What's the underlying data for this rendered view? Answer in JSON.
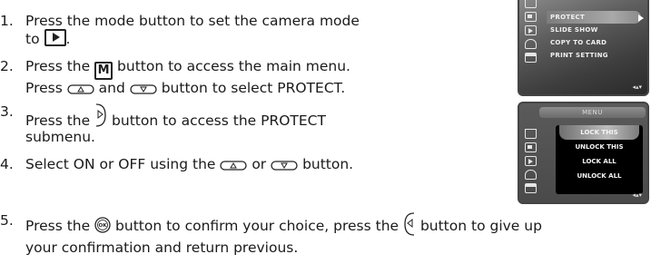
{
  "steps": [
    {
      "num": "1.",
      "line1": "Press the mode button to set the camera mode",
      "line2_pre": "to",
      "line2_post": "."
    },
    {
      "num": "2.",
      "line1_pre": "Press the",
      "line1_post": "button to access the main menu.",
      "line2_pre": "Press",
      "line2_mid": "and",
      "line2_post": "button to select PROTECT."
    },
    {
      "num": "3.",
      "line1_pre": "Press the",
      "line1_post": "button to access the PROTECT",
      "line2": "submenu."
    },
    {
      "num": "4.",
      "line1_pre": "Select ON or OFF using the",
      "line1_mid": "or",
      "line1_post": "button."
    },
    {
      "num": "5.",
      "line1_pre": "Press the",
      "line1_mid": "button to confirm your choice, press the",
      "line1_post": "button to give up",
      "line2": "your confirmation and return previous."
    }
  ],
  "keys": {
    "menu_key": "M",
    "ok_key": "OK"
  },
  "panel_top": {
    "items": [
      "PROTECT",
      "SLIDE SHOW",
      "COPY TO CARD",
      "PRINT SETTING"
    ],
    "nav": "◂▴▾"
  },
  "panel_bottom": {
    "title": "MENU",
    "options": [
      "LOCK THIS",
      "UNLOCK THIS",
      "LOCK ALL",
      "UNLOCK ALL"
    ],
    "nav": "◂▴▾"
  },
  "colors": {
    "text": "#1a1a1a",
    "panel_dark": "#2b2b2b",
    "highlight": "#a9a9a9"
  }
}
